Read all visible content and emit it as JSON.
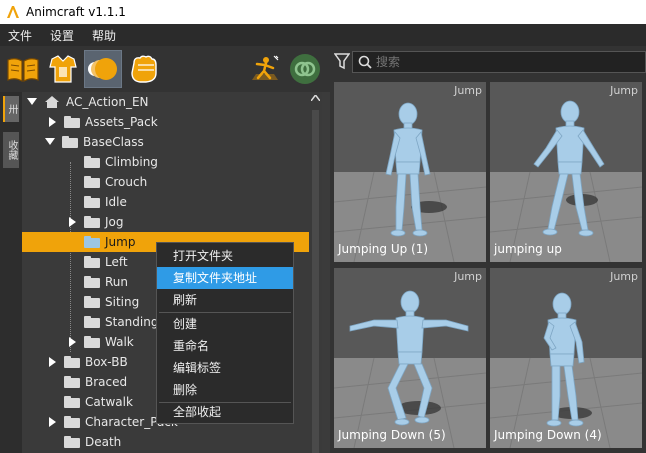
{
  "app": {
    "title": "Animcraft v1.1.1"
  },
  "menu": [
    "文件",
    "设置",
    "帮助"
  ],
  "side_tabs": [
    "卅",
    "收藏"
  ],
  "tree": {
    "root": "AC_Action_EN",
    "items": [
      {
        "label": "Assets_Pack"
      },
      {
        "label": "BaseClass"
      },
      {
        "label": "Climbing"
      },
      {
        "label": "Crouch"
      },
      {
        "label": "Idle"
      },
      {
        "label": "Jog"
      },
      {
        "label": "Jump"
      },
      {
        "label": "Left"
      },
      {
        "label": "Run"
      },
      {
        "label": "Siting"
      },
      {
        "label": "Standing"
      },
      {
        "label": "Walk"
      },
      {
        "label": "Box-BB"
      },
      {
        "label": "Braced"
      },
      {
        "label": "Catwalk"
      },
      {
        "label": "Character_Pack"
      },
      {
        "label": "Death"
      }
    ]
  },
  "context_menu": [
    "打开文件夹",
    "复制文件夹地址",
    "刷新",
    "创建",
    "重命名",
    "编辑标签",
    "删除",
    "全部收起"
  ],
  "search": {
    "placeholder": "搜索"
  },
  "thumbnails": [
    {
      "tag": "Jump",
      "caption": "Jumping Up (1)"
    },
    {
      "tag": "Jump",
      "caption": "jumping up"
    },
    {
      "tag": "Jump",
      "caption": "Jumping Down (5)"
    },
    {
      "tag": "Jump",
      "caption": "Jumping Down (4)"
    }
  ],
  "colors": {
    "accent": "#f0a30a",
    "menu_highlight": "#2f9be6"
  }
}
